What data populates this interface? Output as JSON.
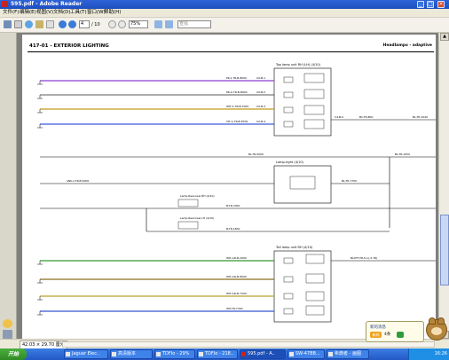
{
  "window": {
    "title": "595.pdf - Adobe Reader"
  },
  "menu": {
    "items": [
      "文件(F)",
      "编辑(E)",
      "视图(V)",
      "文档(D)",
      "工具(T)",
      "窗口(W)",
      "帮助(H)"
    ]
  },
  "toolbar": {
    "page_current": "4",
    "page_total": "/ 10",
    "zoom": "75%",
    "search_placeholder": "查找"
  },
  "document": {
    "header_left": "417-01 - EXTERIOR LIGHTING",
    "header_right": "Headlamps - adaptive",
    "blocks": {
      "top_box_title": "Top lamp unit RH (LH) (4/10)",
      "mid_box_title": "Lamp-right (4/10)",
      "lower_box_title": "Tail lamp unit RH (4/10)",
      "left_small_1": "Lamp-Rearview RH (4/10)",
      "left_small_2": "Lamp-Rearview LH (4/10)"
    },
    "wire_labels": {
      "top1": "PK-1 TR-B-8000",
      "top2": "PK-G TR-B-8000",
      "top3": "WH-G TR-B-7000",
      "top4": "VH-G TR-B-8700",
      "cc1": "C0-B-1",
      "cc2": "C0-B-2",
      "cc3": "C0-B-3",
      "cc4": "C0-B-4",
      "mid_pin": "C4-B-0",
      "right1": "B1-TR-800",
      "right2": "B-TR-1600",
      "far_right": "BL-TR-1040",
      "midA": "BL-TR-5000",
      "midB": "BL-TR-1050",
      "midC": "BL-TR-7700",
      "midD": "B-TR-7000",
      "lowA": "WH-GD-B-2000",
      "lowB": "WH-GD-B-8000",
      "lowC": "WH-GD-B-7200",
      "lowD": "WH-TR-7300",
      "lowRight": "BLOTT-TR-5-1(-3-7R)",
      "gnd_left": "ANK-1-TR-B-6000",
      "g": "GND"
    }
  },
  "statusbar": {
    "page_size": "42.03 × 29.70 厘米"
  },
  "taskbar": {
    "start_label": "开始",
    "items": [
      "Jaguar Elec..",
      "高清版本",
      "TDFIo - 29%",
      "TDFIo - 218..",
      "595.pdf - A..",
      "SW-47BB...",
      "希典者 - 画图"
    ],
    "clock": "16:26"
  },
  "notification": {
    "title": "新的消息",
    "count_text": "4条",
    "badge": "新闻"
  }
}
